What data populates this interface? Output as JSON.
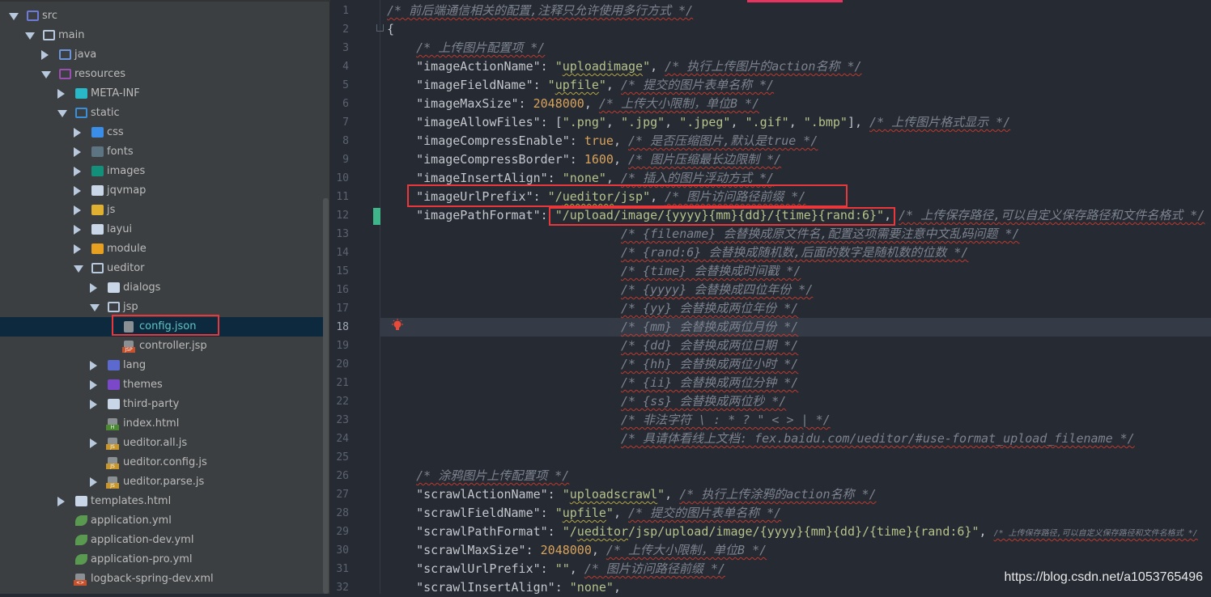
{
  "project_tree": {
    "selected": "config.json",
    "items": [
      {
        "label": "src",
        "level": 0,
        "arrow": "down",
        "icon": "source-folder-icon",
        "color": "#6e7ad8",
        "fill": false
      },
      {
        "label": "main",
        "level": 1,
        "arrow": "down",
        "icon": "folder-icon",
        "color": "#b8c9de",
        "fill": false
      },
      {
        "label": "java",
        "level": 2,
        "arrow": "right",
        "icon": "folder-icon",
        "color": "#6e94d8",
        "fill": false
      },
      {
        "label": "resources",
        "level": 2,
        "arrow": "down",
        "icon": "resources-folder-icon",
        "color": "#9b4fb0",
        "fill": false
      },
      {
        "label": "META-INF",
        "level": 3,
        "arrow": "right",
        "icon": "meta-folder-icon",
        "color": "#28b8c8",
        "fill": true
      },
      {
        "label": "static",
        "level": 3,
        "arrow": "down",
        "icon": "web-folder-icon",
        "color": "#3b8ed8",
        "fill": false
      },
      {
        "label": "css",
        "level": 4,
        "arrow": "right",
        "icon": "css-folder-icon",
        "color": "#3b8ee8",
        "fill": true
      },
      {
        "label": "fonts",
        "level": 4,
        "arrow": "right",
        "icon": "fonts-folder-icon",
        "color": "#5d7582",
        "fill": true
      },
      {
        "label": "images",
        "level": 4,
        "arrow": "right",
        "icon": "images-folder-icon",
        "color": "#13907a",
        "fill": true
      },
      {
        "label": "jqvmap",
        "level": 4,
        "arrow": "right",
        "icon": "folder-icon",
        "color": "#c8d6e8",
        "fill": true
      },
      {
        "label": "js",
        "level": 4,
        "arrow": "right",
        "icon": "js-folder-icon",
        "color": "#e0b030",
        "fill": true
      },
      {
        "label": "layui",
        "level": 4,
        "arrow": "right",
        "icon": "folder-icon",
        "color": "#c8d6e8",
        "fill": true
      },
      {
        "label": "module",
        "level": 4,
        "arrow": "right",
        "icon": "module-folder-icon",
        "color": "#e8a020",
        "fill": true
      },
      {
        "label": "ueditor",
        "level": 4,
        "arrow": "down",
        "icon": "folder-icon",
        "color": "#b8c9de",
        "fill": false
      },
      {
        "label": "dialogs",
        "level": 5,
        "arrow": "right",
        "icon": "folder-icon",
        "color": "#c8d6e8",
        "fill": true
      },
      {
        "label": "jsp",
        "level": 5,
        "arrow": "down",
        "icon": "folder-icon",
        "color": "#b8c9de",
        "fill": false
      },
      {
        "label": "config.json",
        "level": 6,
        "arrow": "none",
        "icon": "json-file-icon",
        "color": "#8a8f94",
        "fill": true,
        "tag": ""
      },
      {
        "label": "controller.jsp",
        "level": 6,
        "arrow": "none",
        "icon": "jsp-file-icon",
        "color": "#8a8f94",
        "fill": true,
        "tag": "JSP",
        "tagcolor": "#c8502a"
      },
      {
        "label": "lang",
        "level": 5,
        "arrow": "right",
        "icon": "lang-folder-icon",
        "color": "#5c6ad0",
        "fill": true
      },
      {
        "label": "themes",
        "level": 5,
        "arrow": "right",
        "icon": "themes-folder-icon",
        "color": "#7a48c8",
        "fill": true
      },
      {
        "label": "third-party",
        "level": 5,
        "arrow": "right",
        "icon": "folder-icon",
        "color": "#c8d6e8",
        "fill": true
      },
      {
        "label": "index.html",
        "level": 5,
        "arrow": "none",
        "icon": "html-file-icon",
        "color": "#8a8f94",
        "fill": true,
        "tag": "H",
        "tagcolor": "#4a8a30"
      },
      {
        "label": "ueditor.all.js",
        "level": 5,
        "arrow": "right",
        "icon": "js-file-icon",
        "color": "#8a8f94",
        "fill": true,
        "tag": "JS",
        "tagcolor": "#c8962a"
      },
      {
        "label": "ueditor.config.js",
        "level": 5,
        "arrow": "none",
        "icon": "js-file-icon",
        "color": "#8a8f94",
        "fill": true,
        "tag": "JS",
        "tagcolor": "#c8962a"
      },
      {
        "label": "ueditor.parse.js",
        "level": 5,
        "arrow": "right",
        "icon": "js-file-icon",
        "color": "#8a8f94",
        "fill": true,
        "tag": "JS",
        "tagcolor": "#c8962a"
      },
      {
        "label": "templates.html",
        "level": 3,
        "arrow": "right",
        "icon": "folder-icon",
        "color": "#c8d6e8",
        "fill": true
      },
      {
        "label": "application.yml",
        "level": 3,
        "arrow": "none",
        "icon": "spring-yml-icon",
        "color": "#5a9a50",
        "fill": true
      },
      {
        "label": "application-dev.yml",
        "level": 3,
        "arrow": "none",
        "icon": "spring-yml-icon",
        "color": "#5a9a50",
        "fill": true
      },
      {
        "label": "application-pro.yml",
        "level": 3,
        "arrow": "none",
        "icon": "spring-yml-icon",
        "color": "#5a9a50",
        "fill": true
      },
      {
        "label": "logback-spring-dev.xml",
        "level": 3,
        "arrow": "none",
        "icon": "xml-file-icon",
        "color": "#8a8f94",
        "fill": true,
        "tag": "<>",
        "tagcolor": "#c8502a"
      }
    ]
  },
  "editor": {
    "current_line": 18,
    "changed_line": 12,
    "highlighted_lines": [
      11,
      12
    ],
    "lines": [
      {
        "n": 1,
        "i": 0,
        "t": [
          [
            "c",
            "/* 前后端通信相关的配置,注释只允许使用多行方式 */"
          ]
        ]
      },
      {
        "n": 2,
        "i": 0,
        "t": [
          [
            "p",
            "{"
          ]
        ]
      },
      {
        "n": 3,
        "i": 4,
        "t": [
          [
            "c",
            "/* 上传图片配置项 */"
          ]
        ]
      },
      {
        "n": 4,
        "i": 4,
        "t": [
          [
            "k",
            "\"imageActionName\""
          ],
          [
            "p",
            ": "
          ],
          [
            "s",
            "\""
          ],
          [
            "s sw",
            "uploadimage"
          ],
          [
            "s",
            "\""
          ],
          [
            "p",
            ", "
          ],
          [
            "c",
            "/* 执行上传图片的action名称 */"
          ]
        ]
      },
      {
        "n": 5,
        "i": 4,
        "t": [
          [
            "k",
            "\"imageFieldName\""
          ],
          [
            "p",
            ": "
          ],
          [
            "s",
            "\""
          ],
          [
            "s sw",
            "upfile"
          ],
          [
            "s",
            "\""
          ],
          [
            "p",
            ", "
          ],
          [
            "c",
            "/* 提交的图片表单名称 */"
          ]
        ]
      },
      {
        "n": 6,
        "i": 4,
        "t": [
          [
            "k",
            "\"imageMaxSize\""
          ],
          [
            "p",
            ": "
          ],
          [
            "n",
            "2048000"
          ],
          [
            "p",
            ", "
          ],
          [
            "c",
            "/* 上传大小限制，单位B */"
          ]
        ]
      },
      {
        "n": 7,
        "i": 4,
        "t": [
          [
            "k",
            "\"imageAllowFiles\""
          ],
          [
            "p",
            ": ["
          ],
          [
            "s",
            "\".png\""
          ],
          [
            "p",
            ", "
          ],
          [
            "s",
            "\".jpg\""
          ],
          [
            "p",
            ", "
          ],
          [
            "s",
            "\".jpeg\""
          ],
          [
            "p",
            ", "
          ],
          [
            "s",
            "\".gif\""
          ],
          [
            "p",
            ", "
          ],
          [
            "s",
            "\".bmp\""
          ],
          [
            "p",
            "], "
          ],
          [
            "c",
            "/* 上传图片格式显示 */"
          ]
        ]
      },
      {
        "n": 8,
        "i": 4,
        "t": [
          [
            "k",
            "\"imageCompressEnable\""
          ],
          [
            "p",
            ": "
          ],
          [
            "b",
            "true"
          ],
          [
            "p",
            ", "
          ],
          [
            "c",
            "/* 是否压缩图片,默认是true */"
          ]
        ]
      },
      {
        "n": 9,
        "i": 4,
        "t": [
          [
            "k",
            "\"imageCompressBorder\""
          ],
          [
            "p",
            ": "
          ],
          [
            "n",
            "1600"
          ],
          [
            "p",
            ", "
          ],
          [
            "c",
            "/* 图片压缩最长边限制 */"
          ]
        ]
      },
      {
        "n": 10,
        "i": 4,
        "t": [
          [
            "k",
            "\"imageInsertAlign\""
          ],
          [
            "p",
            ": "
          ],
          [
            "s",
            "\"none\""
          ],
          [
            "p",
            ", "
          ],
          [
            "c",
            "/* 插入的图片浮动方式 */"
          ]
        ]
      },
      {
        "n": 11,
        "i": 4,
        "t": [
          [
            "k",
            "\"imageUrlPrefix\""
          ],
          [
            "p",
            ": "
          ],
          [
            "s",
            "\"/"
          ],
          [
            "s sw",
            "ueditor"
          ],
          [
            "s",
            "/jsp\""
          ],
          [
            "p",
            ", "
          ],
          [
            "c",
            "/* 图片访问路径前缀 */"
          ]
        ]
      },
      {
        "n": 12,
        "i": 4,
        "t": [
          [
            "k",
            "\"imagePathFormat\""
          ],
          [
            "p",
            ": "
          ],
          [
            "s",
            "\"/upload/image/{yyyy}{mm}{dd}/{time}{rand:6}\""
          ],
          [
            "p",
            ", "
          ],
          [
            "c",
            "/* 上传保存路径,可以自定义保存路径和文件名格式 */"
          ]
        ]
      },
      {
        "n": 13,
        "i": 32,
        "t": [
          [
            "c",
            "/* {filename} 会替换成原文件名,配置这项需要注意中文乱码问题 */"
          ]
        ]
      },
      {
        "n": 14,
        "i": 32,
        "t": [
          [
            "c",
            "/* {rand:6} 会替换成随机数,后面的数字是随机数的位数 */"
          ]
        ]
      },
      {
        "n": 15,
        "i": 32,
        "t": [
          [
            "c",
            "/* {time} 会替换成时间戳 */"
          ]
        ]
      },
      {
        "n": 16,
        "i": 32,
        "t": [
          [
            "c",
            "/* {yyyy} 会替换成四位年份 */"
          ]
        ]
      },
      {
        "n": 17,
        "i": 32,
        "t": [
          [
            "c",
            "/* {yy} 会替换成两位年份 */"
          ]
        ]
      },
      {
        "n": 18,
        "i": 32,
        "t": [
          [
            "c",
            "/* {mm} 会替换成两位月份 */"
          ]
        ]
      },
      {
        "n": 19,
        "i": 32,
        "t": [
          [
            "c",
            "/* {dd} 会替换成两位日期 */"
          ]
        ]
      },
      {
        "n": 20,
        "i": 32,
        "t": [
          [
            "c",
            "/* {hh} 会替换成两位小时 */"
          ]
        ]
      },
      {
        "n": 21,
        "i": 32,
        "t": [
          [
            "c",
            "/* {ii} 会替换成两位分钟 */"
          ]
        ]
      },
      {
        "n": 22,
        "i": 32,
        "t": [
          [
            "c",
            "/* {ss} 会替换成两位秒 */"
          ]
        ]
      },
      {
        "n": 23,
        "i": 32,
        "t": [
          [
            "c",
            "/* 非法字符 \\ : * ? \" < > | */"
          ]
        ]
      },
      {
        "n": 24,
        "i": 32,
        "t": [
          [
            "c",
            "/* 具请体看线上文档: fex.baidu.com/ueditor/#use-format_upload_filename */"
          ]
        ]
      },
      {
        "n": 25,
        "i": 0,
        "t": []
      },
      {
        "n": 26,
        "i": 4,
        "t": [
          [
            "c",
            "/* 涂鸦图片上传配置项 */"
          ]
        ]
      },
      {
        "n": 27,
        "i": 4,
        "t": [
          [
            "k",
            "\"scrawlActionName\""
          ],
          [
            "p",
            ": "
          ],
          [
            "s",
            "\""
          ],
          [
            "s sw",
            "uploadscrawl"
          ],
          [
            "s",
            "\""
          ],
          [
            "p",
            ", "
          ],
          [
            "c",
            "/* 执行上传涂鸦的action名称 */"
          ]
        ]
      },
      {
        "n": 28,
        "i": 4,
        "t": [
          [
            "k",
            "\"scrawlFieldName\""
          ],
          [
            "p",
            ": "
          ],
          [
            "s",
            "\""
          ],
          [
            "s sw",
            "upfile"
          ],
          [
            "s",
            "\""
          ],
          [
            "p",
            ", "
          ],
          [
            "c",
            "/* 提交的图片表单名称 */"
          ]
        ]
      },
      {
        "n": 29,
        "i": 4,
        "t": [
          [
            "k",
            "\"scrawlPathFormat\""
          ],
          [
            "p",
            ": "
          ],
          [
            "s",
            "\"/"
          ],
          [
            "s sw",
            "ueditor"
          ],
          [
            "s",
            "/jsp/upload/image/{yyyy}{mm}{dd}/{time}{rand:6}\""
          ],
          [
            "p",
            ", "
          ],
          [
            "c",
            "/* 上传保存路径,可以自定义保存路径和文件名格式 */"
          ]
        ]
      },
      {
        "n": 30,
        "i": 4,
        "t": [
          [
            "k",
            "\"scrawlMaxSize\""
          ],
          [
            "p",
            ": "
          ],
          [
            "n",
            "2048000"
          ],
          [
            "p",
            ", "
          ],
          [
            "c",
            "/* 上传大小限制，单位B */"
          ]
        ]
      },
      {
        "n": 31,
        "i": 4,
        "t": [
          [
            "k",
            "\"scrawlUrlPrefix\""
          ],
          [
            "p",
            ": "
          ],
          [
            "s",
            "\"\""
          ],
          [
            "p",
            ", "
          ],
          [
            "c",
            "/* 图片访问路径前缀 */"
          ]
        ]
      },
      {
        "n": 32,
        "i": 4,
        "t": [
          [
            "k",
            "\"scrawlInsertAlign\""
          ],
          [
            "p",
            ": "
          ],
          [
            "s",
            "\"none\""
          ],
          [
            "p",
            ","
          ]
        ]
      }
    ]
  },
  "watermark": "https://blog.csdn.net/a1053765496",
  "colors": {
    "accent": "#e6335f",
    "highlight_box": "#e8383b",
    "selection": "#0d293e",
    "vcs_changed": "#3fb68a"
  }
}
